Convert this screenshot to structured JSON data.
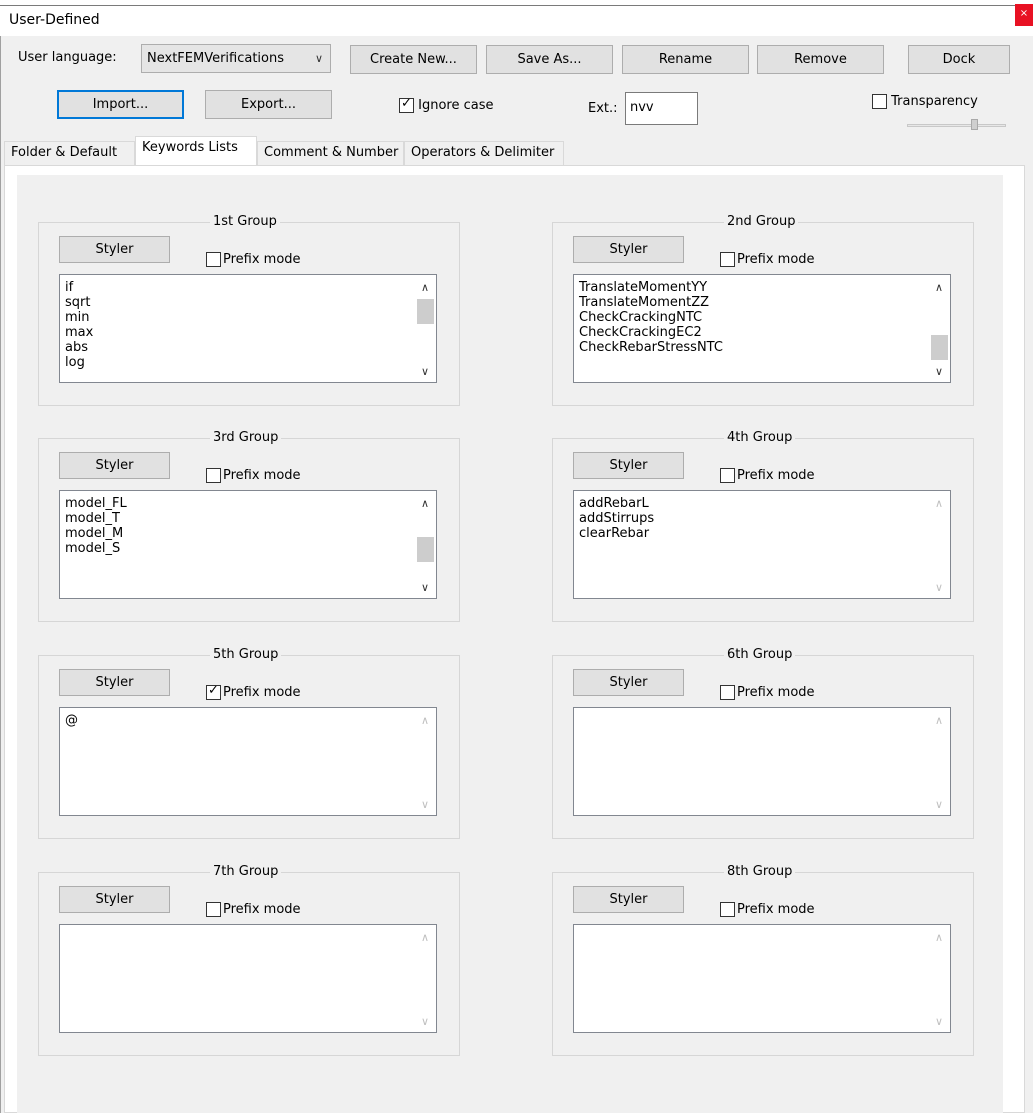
{
  "window": {
    "title": "User-Defined",
    "close_glyph": "×"
  },
  "toolbar": {
    "user_language_label": "User language:",
    "user_language_value": "NextFEMVerifications",
    "create_new": "Create New...",
    "save_as": "Save As...",
    "rename": "Rename",
    "remove": "Remove",
    "dock": "Dock",
    "import": "Import...",
    "export": "Export...",
    "ignore_case_label": "Ignore case",
    "ignore_case_checked": true,
    "ext_label": "Ext.:",
    "ext_value": "nvv",
    "transparency_label": "Transparency",
    "transparency_checked": false
  },
  "tabs": [
    {
      "label": "Folder & Default",
      "active": false
    },
    {
      "label": "Keywords Lists",
      "active": true
    },
    {
      "label": "Comment & Number",
      "active": false
    },
    {
      "label": "Operators & Delimiter",
      "active": false
    }
  ],
  "groups": [
    {
      "title": "1st Group",
      "styler": "Styler",
      "prefix_label": "Prefix mode",
      "prefix_checked": false,
      "items": [
        "if",
        "sqrt",
        "min",
        "max",
        "abs",
        "log"
      ],
      "scroll_enabled": true,
      "thumb_position": 0.1
    },
    {
      "title": "2nd Group",
      "styler": "Styler",
      "prefix_label": "Prefix mode",
      "prefix_checked": false,
      "items": [
        "TranslateMomentYY",
        "TranslateMomentZZ",
        "CheckCrackingNTC",
        "CheckCrackingEC2",
        "CheckRebarStressNTC"
      ],
      "scroll_enabled": true,
      "thumb_position": 0.9
    },
    {
      "title": "3rd Group",
      "styler": "Styler",
      "prefix_label": "Prefix mode",
      "prefix_checked": false,
      "items": [
        "model_FL",
        "model_T",
        "model_M",
        "model_S"
      ],
      "scroll_enabled": true,
      "thumb_position": 0.6
    },
    {
      "title": "4th Group",
      "styler": "Styler",
      "prefix_label": "Prefix mode",
      "prefix_checked": false,
      "items": [
        "addRebarL",
        "addStirrups",
        "clearRebar"
      ],
      "scroll_enabled": false
    },
    {
      "title": "5th Group",
      "styler": "Styler",
      "prefix_label": "Prefix mode",
      "prefix_checked": true,
      "items": [
        "@"
      ],
      "scroll_enabled": false
    },
    {
      "title": "6th Group",
      "styler": "Styler",
      "prefix_label": "Prefix mode",
      "prefix_checked": false,
      "items": [],
      "scroll_enabled": false
    },
    {
      "title": "7th Group",
      "styler": "Styler",
      "prefix_label": "Prefix mode",
      "prefix_checked": false,
      "items": [],
      "scroll_enabled": false
    },
    {
      "title": "8th Group",
      "styler": "Styler",
      "prefix_label": "Prefix mode",
      "prefix_checked": false,
      "items": [],
      "scroll_enabled": false
    }
  ],
  "glyphs": {
    "check": "✓",
    "combo_chevron": "∨",
    "scroll_up": "∧",
    "scroll_down": "∨"
  }
}
